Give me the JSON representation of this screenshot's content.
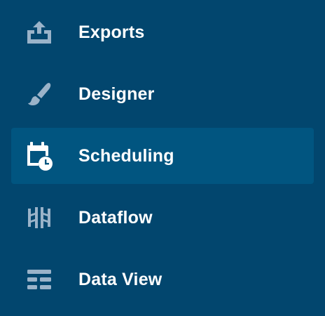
{
  "colors": {
    "background": "#02466e",
    "active_background": "#015580",
    "icon_inactive": "#9ab3c9",
    "icon_active": "#ffffff",
    "label": "#ffffff"
  },
  "nav": {
    "active_index": 2,
    "items": [
      {
        "label": "Exports",
        "icon": "upload-icon"
      },
      {
        "label": "Designer",
        "icon": "paintbrush-icon"
      },
      {
        "label": "Scheduling",
        "icon": "calendar-clock-icon"
      },
      {
        "label": "Dataflow",
        "icon": "dataflow-icon"
      },
      {
        "label": "Data View",
        "icon": "table-view-icon"
      }
    ]
  }
}
